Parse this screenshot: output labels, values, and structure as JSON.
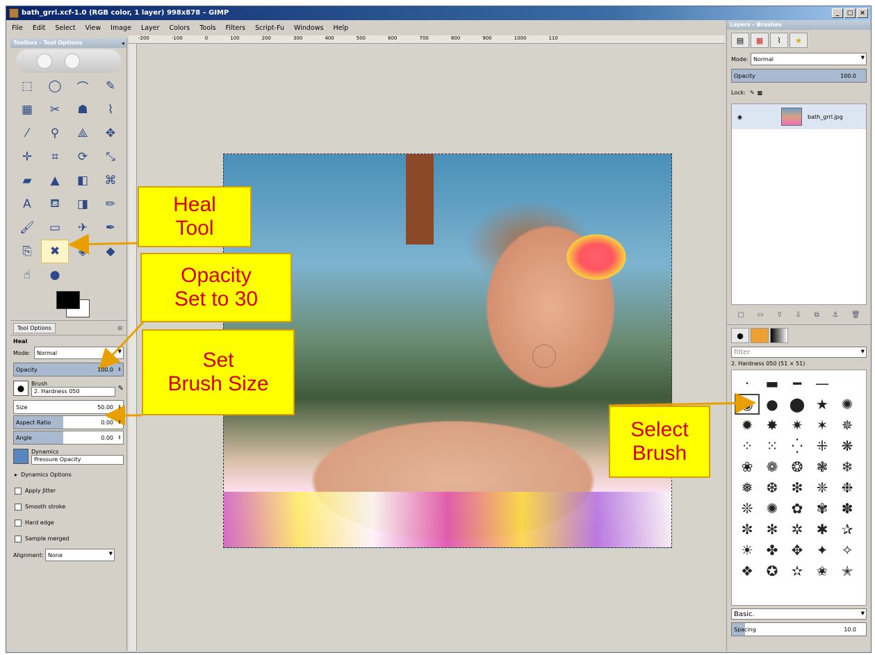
{
  "window": {
    "title": "bath_grrl.xcf-1.0 (RGB color, 1 layer) 998x878 – GIMP",
    "controls": [
      "_",
      "□",
      "×"
    ]
  },
  "menubar": [
    "File",
    "Edit",
    "Select",
    "View",
    "Image",
    "Layer",
    "Colors",
    "Tools",
    "Filters",
    "Script-Fu",
    "Windows",
    "Help"
  ],
  "toolbox": {
    "title": "Toolbox - Tool Options",
    "tools": [
      {
        "name": "rect-select-icon",
        "glyph": "⬚"
      },
      {
        "name": "ellipse-select-icon",
        "glyph": "◯"
      },
      {
        "name": "free-select-icon",
        "glyph": "⌒"
      },
      {
        "name": "fuzzy-select-icon",
        "glyph": "✎"
      },
      {
        "name": "select-by-color-icon",
        "glyph": "▦"
      },
      {
        "name": "scissors-icon",
        "glyph": "✂"
      },
      {
        "name": "foreground-select-icon",
        "glyph": "☗"
      },
      {
        "name": "paths-icon",
        "glyph": "⌇"
      },
      {
        "name": "color-picker-icon",
        "glyph": "⁄"
      },
      {
        "name": "zoom-icon",
        "glyph": "⚲"
      },
      {
        "name": "measure-icon",
        "glyph": "⟁"
      },
      {
        "name": "move-icon",
        "glyph": "✥"
      },
      {
        "name": "align-icon",
        "glyph": "✛"
      },
      {
        "name": "crop-icon",
        "glyph": "⌗"
      },
      {
        "name": "rotate-icon",
        "glyph": "⟳"
      },
      {
        "name": "scale-icon",
        "glyph": "⤡"
      },
      {
        "name": "shear-icon",
        "glyph": "▰"
      },
      {
        "name": "perspective-icon",
        "glyph": "▲"
      },
      {
        "name": "flip-icon",
        "glyph": "◧"
      },
      {
        "name": "cage-icon",
        "glyph": "⌘"
      },
      {
        "name": "text-icon",
        "glyph": "A"
      },
      {
        "name": "bucket-fill-icon",
        "glyph": "⛾"
      },
      {
        "name": "blend-icon",
        "glyph": "◨"
      },
      {
        "name": "pencil-icon",
        "glyph": "✏"
      },
      {
        "name": "paintbrush-icon",
        "glyph": "🖌"
      },
      {
        "name": "eraser-icon",
        "glyph": "▭"
      },
      {
        "name": "airbrush-icon",
        "glyph": "✈"
      },
      {
        "name": "ink-icon",
        "glyph": "✒"
      },
      {
        "name": "clone-icon",
        "glyph": "⎘"
      },
      {
        "name": "heal-icon",
        "glyph": "✖"
      },
      {
        "name": "perspective-clone-icon",
        "glyph": "◈"
      },
      {
        "name": "blur-sharpen-icon",
        "glyph": "◆"
      },
      {
        "name": "smudge-icon",
        "glyph": "☝"
      },
      {
        "name": "dodge-burn-icon",
        "glyph": "●"
      }
    ],
    "active_tool_index": 29
  },
  "tool_options": {
    "tab_label": "Tool Options",
    "tool_name": "Heal",
    "mode_label": "Mode:",
    "mode_value": "Normal",
    "opacity_label": "Opacity",
    "opacity_value": "100.0",
    "opacity_fraction": 1.0,
    "brush_label": "Brush",
    "brush_value": "2. Hardness 050",
    "size_label": "Size",
    "size_value": "50.00",
    "size_fraction": 0.0,
    "aspect_label": "Aspect Ratio",
    "aspect_value": "0.00",
    "angle_label": "Angle",
    "angle_value": "0.00",
    "dynamics_label": "Dynamics",
    "dynamics_value": "Pressure Opacity",
    "dynamics_options": "Dynamics Options",
    "checkboxes": [
      "Apply Jitter",
      "Smooth stroke",
      "Hard edge",
      "Sample merged"
    ],
    "alignment_label": "Alignment:",
    "alignment_value": "None"
  },
  "ruler_ticks": [
    "-200",
    "-100",
    "0",
    "100",
    "200",
    "300",
    "400",
    "500",
    "600",
    "700",
    "800",
    "900",
    "1000",
    "110"
  ],
  "layers_dock": {
    "title": "Layers - Brushes",
    "mode_label": "Mode:",
    "mode_value": "Normal",
    "opacity_label": "Opacity",
    "opacity_value": "100.0",
    "lock_label": "Lock:",
    "layer_name": "bath_grrl.jpg"
  },
  "brushes_dock": {
    "filter_placeholder": "filter",
    "selected_brush": "2. Hardness 050 (51 × 51)",
    "preset_value": "Basic.",
    "spacing_label": "Spacing",
    "spacing_value": "10.0"
  },
  "annotations": {
    "heal": "Heal\nTool",
    "opacity": "Opacity\nSet to 30",
    "brush_size": "Set\nBrush Size",
    "select_brush": "Select\nBrush"
  },
  "colors": {
    "callout_bg": "#ffff00",
    "callout_text": "#d40000",
    "arrow": "#e8a000"
  }
}
